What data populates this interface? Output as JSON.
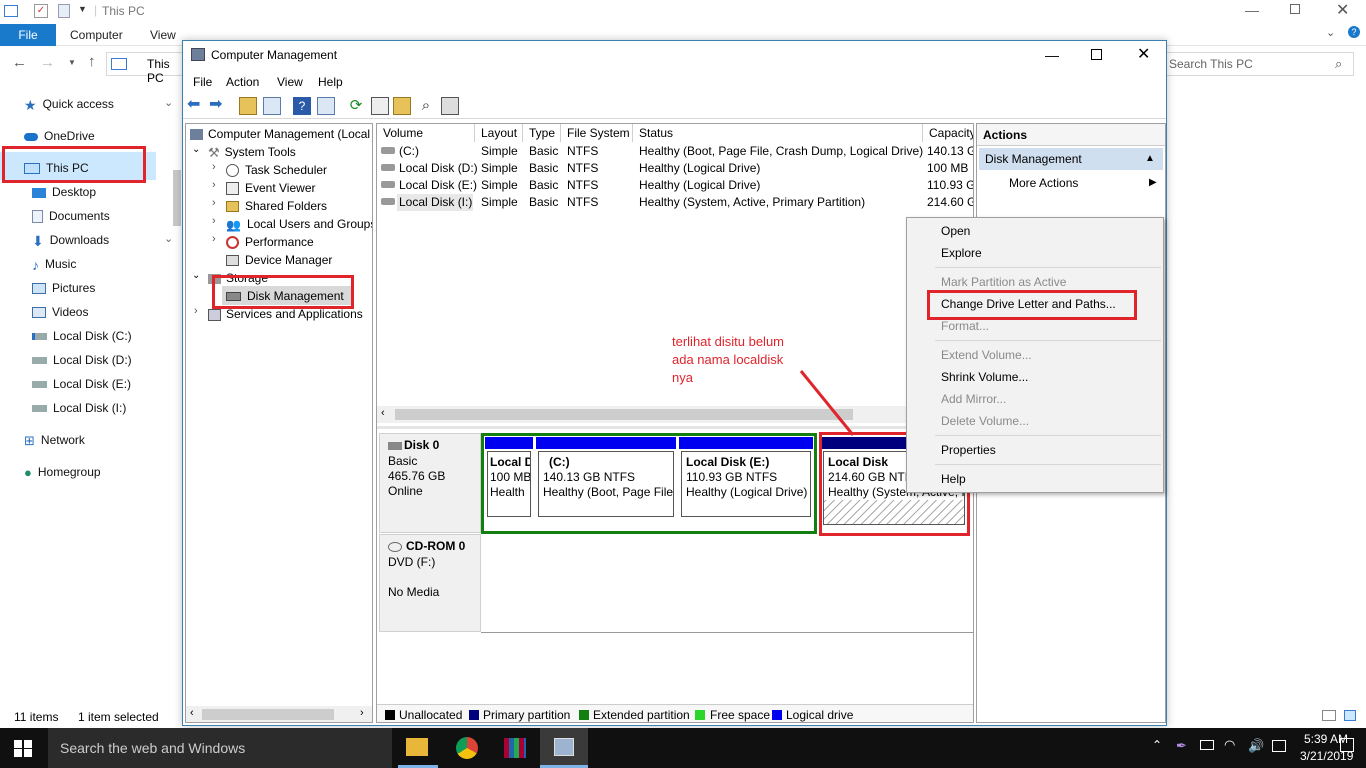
{
  "explorer": {
    "title": "This PC",
    "tabs": {
      "file": "File",
      "computer": "Computer",
      "view": "View"
    },
    "address": "This PC",
    "search_placeholder": "Search This PC",
    "nav": {
      "quick_access": "Quick access",
      "onedrive": "OneDrive",
      "this_pc": "This PC",
      "desktop": "Desktop",
      "documents": "Documents",
      "downloads": "Downloads",
      "music": "Music",
      "pictures": "Pictures",
      "videos": "Videos",
      "disk_c": "Local Disk (C:)",
      "disk_d": "Local Disk (D:)",
      "disk_e": "Local Disk (E:)",
      "disk_i": "Local Disk (I:)",
      "network": "Network",
      "homegroup": "Homegroup"
    },
    "status": {
      "items": "11 items",
      "selected": "1 item selected"
    }
  },
  "mmc": {
    "title": "Computer Management",
    "menu": {
      "file": "File",
      "action": "Action",
      "view": "View",
      "help": "Help"
    },
    "tree": {
      "root": "Computer Management (Local",
      "system_tools": "System Tools",
      "task_scheduler": "Task Scheduler",
      "event_viewer": "Event Viewer",
      "shared_folders": "Shared Folders",
      "local_users": "Local Users and Groups",
      "performance": "Performance",
      "device_manager": "Device Manager",
      "storage": "Storage",
      "disk_management": "Disk Management",
      "services": "Services and Applications"
    },
    "volume_columns": {
      "volume": "Volume",
      "layout": "Layout",
      "type": "Type",
      "fs": "File System",
      "status": "Status",
      "capacity": "Capacity"
    },
    "volumes": [
      {
        "volume": "(C:)",
        "layout": "Simple",
        "type": "Basic",
        "fs": "NTFS",
        "status": "Healthy (Boot, Page File, Crash Dump, Logical Drive)",
        "capacity": "140.13 G"
      },
      {
        "volume": "Local Disk (D:)",
        "layout": "Simple",
        "type": "Basic",
        "fs": "NTFS",
        "status": "Healthy (Logical Drive)",
        "capacity": "100 MB"
      },
      {
        "volume": "Local Disk (E:)",
        "layout": "Simple",
        "type": "Basic",
        "fs": "NTFS",
        "status": "Healthy (Logical Drive)",
        "capacity": "110.93 G"
      },
      {
        "volume": "Local Disk (I:)",
        "layout": "Simple",
        "type": "Basic",
        "fs": "NTFS",
        "status": "Healthy (System, Active, Primary Partition)",
        "capacity": "214.60 G"
      }
    ],
    "disk0": {
      "name": "Disk 0",
      "type": "Basic",
      "size": "465.76 GB",
      "state": "Online"
    },
    "partitions": {
      "p1": {
        "name": "Local D",
        "size": "100 MB",
        "status": "Health"
      },
      "p2": {
        "name": "(C:)",
        "size": "140.13 GB NTFS",
        "status": "Healthy (Boot, Page File,"
      },
      "p3": {
        "name": "Local Disk  (E:)",
        "size": "110.93 GB NTFS",
        "status": "Healthy (Logical Drive)"
      },
      "p4": {
        "name": "Local Disk",
        "size": "214.60 GB NTFS",
        "status": "Healthy (System, Active, I"
      }
    },
    "cdrom": {
      "name": "CD-ROM 0",
      "drive": "DVD (F:)",
      "media": "No Media"
    },
    "legend": {
      "unallocated": "Unallocated",
      "primary": "Primary partition",
      "extended": "Extended partition",
      "free": "Free space",
      "logical": "Logical drive"
    },
    "actions": {
      "header": "Actions",
      "section": "Disk Management",
      "more": "More Actions"
    }
  },
  "context_menu": {
    "open": "Open",
    "explore": "Explore",
    "mark_active": "Mark Partition as Active",
    "change_letter": "Change Drive Letter and Paths...",
    "format": "Format...",
    "extend": "Extend Volume...",
    "shrink": "Shrink Volume...",
    "mirror": "Add Mirror...",
    "delete": "Delete Volume...",
    "properties": "Properties",
    "help": "Help"
  },
  "annotation": {
    "line1": "terlihat disitu belum",
    "line2": "ada nama localdisk",
    "line3": "nya"
  },
  "taskbar": {
    "search": "Search the web and Windows",
    "time": "5:39 AM",
    "date": "3/21/2019"
  },
  "colors": {
    "primary": "#00007f",
    "extended": "#118011",
    "free": "#2bd62b",
    "logical": "#0000f0",
    "annotation": "#e0242c",
    "accent": "#1979ca"
  }
}
